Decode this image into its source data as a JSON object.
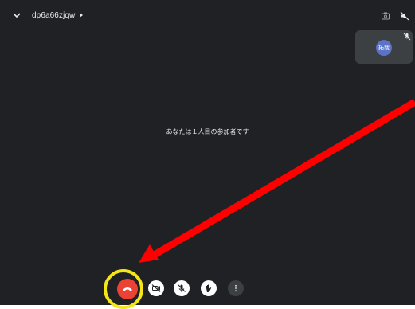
{
  "header": {
    "meeting_code": "dp6a66zjqw"
  },
  "self_view": {
    "avatar_text": "拓哉"
  },
  "main": {
    "status_message": "あなたは１人目の参加者です"
  },
  "controls": {
    "end_call_icon": "call-end-icon",
    "camera_icon": "camera-off-icon",
    "mic_icon": "mic-off-icon",
    "hand_icon": "raise-hand-icon",
    "more_icon": "more-vert-icon"
  },
  "annotations": {
    "arrow_color": "#ff0000",
    "highlight_color": "#f5e61a"
  }
}
